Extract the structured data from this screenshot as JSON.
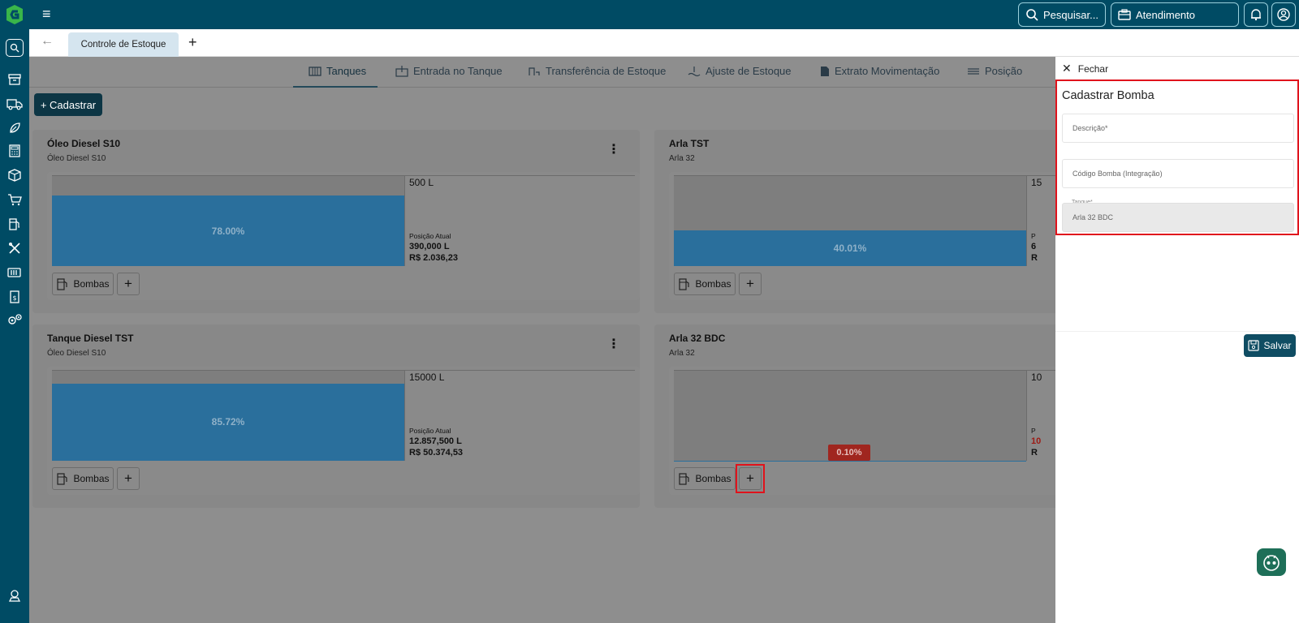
{
  "topbar": {
    "search_label": "Pesquisar...",
    "atendimento_label": "Atendimento"
  },
  "sidebar": {
    "icons": [
      "search-icon",
      "archive-icon",
      "truck-icon",
      "leaf-icon",
      "calculator-icon",
      "box-icon",
      "cart-icon",
      "fuel-pump-icon",
      "tools-icon",
      "battery-icon",
      "invoice-icon",
      "settings-icon",
      "support-icon"
    ]
  },
  "tabs": {
    "open_tab": "Controle de Estoque",
    "add": "+"
  },
  "nav": {
    "items": [
      {
        "label": "Tanques",
        "icon": "tank-icon"
      },
      {
        "label": "Entrada no Tanque",
        "icon": "entry-icon"
      },
      {
        "label": "Transferência de Estoque",
        "icon": "transfer-icon"
      },
      {
        "label": "Ajuste de Estoque",
        "icon": "adjust-icon"
      },
      {
        "label": "Extrato Movimentação",
        "icon": "document-icon"
      },
      {
        "label": "Posição",
        "icon": "position-icon"
      }
    ]
  },
  "actions": {
    "cadastrar": "+ Cadastrar"
  },
  "cards": [
    {
      "title": "Óleo Diesel S10",
      "subtitle": "Óleo Diesel S10",
      "capacity": "500 L",
      "percent": "78.00%",
      "fill": 0.78,
      "pos_label": "Posição Atual",
      "pos_qty": "390,000 L",
      "pos_value": "R$ 2.036,23",
      "bombas": "Bombas"
    },
    {
      "title": "Arla TST",
      "subtitle": "Arla 32",
      "capacity": "15",
      "percent": "40.01%",
      "fill": 0.4001,
      "pos_label": "P",
      "pos_qty": "6",
      "pos_value": "R",
      "bombas": "Bombas"
    },
    {
      "title": "Tanque Diesel TST",
      "subtitle": "Óleo Diesel S10",
      "capacity": "15000 L",
      "percent": "85.72%",
      "fill": 0.8572,
      "pos_label": "Posição Atual",
      "pos_qty": "12.857,500 L",
      "pos_value": "R$ 50.374,53",
      "bombas": "Bombas"
    },
    {
      "title": "Arla 32 BDC",
      "subtitle": "Arla 32",
      "capacity": "10",
      "percent": "0.10%",
      "fill": 0.001,
      "pos_label": "P",
      "pos_qty": "10",
      "pos_value": "R",
      "bombas": "Bombas"
    }
  ],
  "panel": {
    "close_label": "Fechar",
    "title": "Cadastrar Bomba",
    "descricao_placeholder": "Descrição*",
    "codigo_placeholder": "Código Bomba (Integração)",
    "tanque_label": "Tanque*",
    "tanque_value": "Arla 32 BDC",
    "save_label": "Salvar"
  },
  "colors": {
    "brand": "#004b64",
    "highlight": "#e0131c",
    "tank_fill": "#2a6f9c"
  }
}
